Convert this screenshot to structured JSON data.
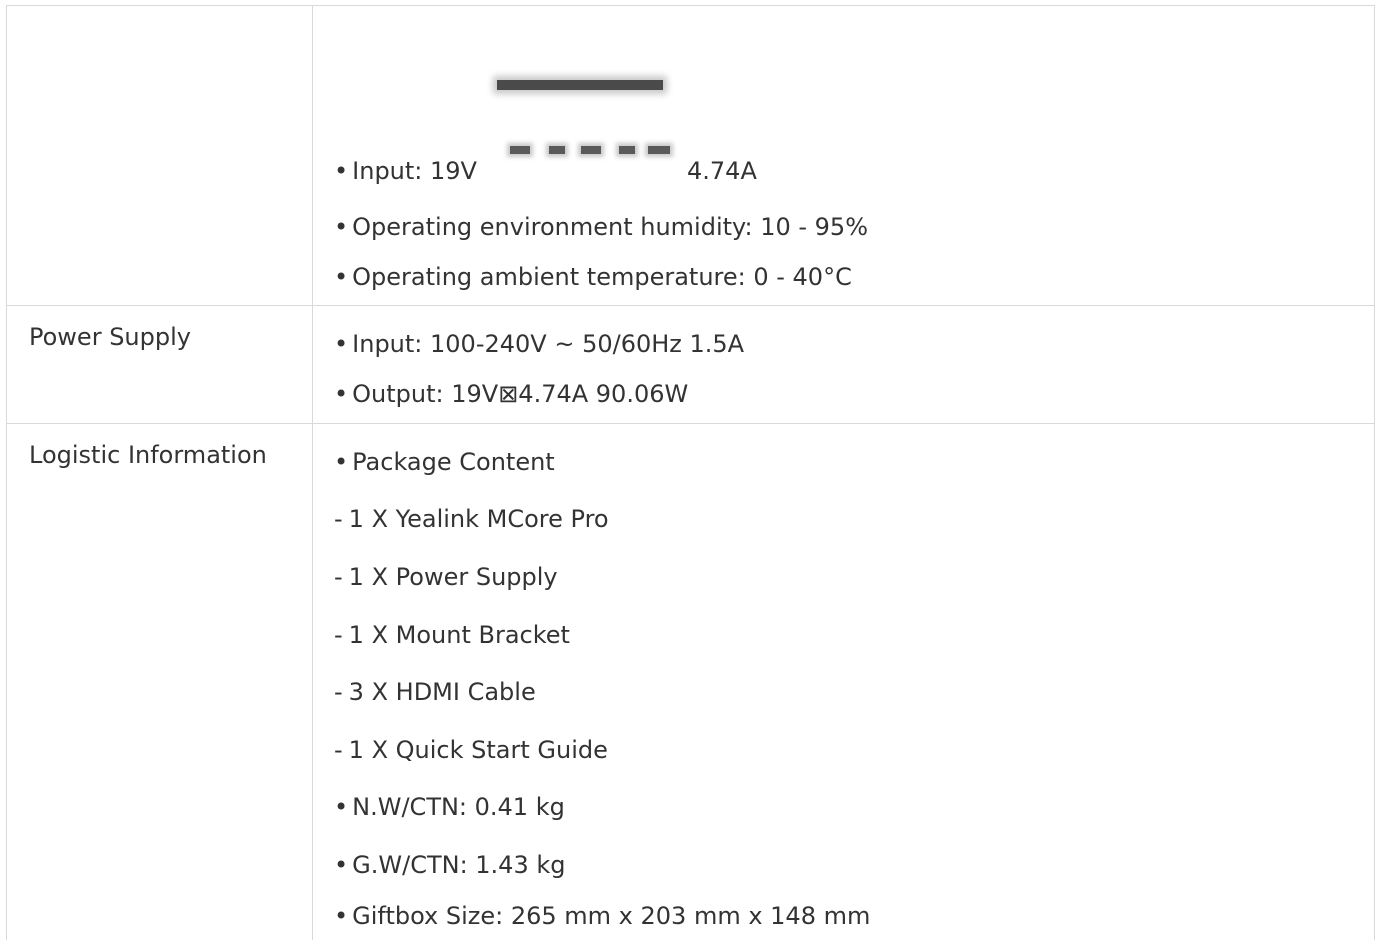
{
  "rows": [
    {
      "label": "",
      "lines": [
        {
          "prefix": "bullet",
          "text": "Input: 19V",
          "suffix": "4.74A"
        },
        {
          "prefix": "bullet",
          "text": "Operating environment humidity: 10 - 95%"
        },
        {
          "prefix": "bullet",
          "text": "Operating ambient temperature: 0 - 40°C"
        }
      ]
    },
    {
      "label": "Power Supply",
      "lines": [
        {
          "prefix": "bullet",
          "text": "Input: 100-240V ~ 50/60Hz 1.5A"
        },
        {
          "prefix": "bullet",
          "text": "Output: 19V⊠4.74A 90.06W"
        }
      ]
    },
    {
      "label": "Logistic Information",
      "lines": [
        {
          "prefix": "bullet",
          "text": "Package Content"
        },
        {
          "prefix": "dash",
          "text": "1 X Yealink MCore Pro"
        },
        {
          "prefix": "dash",
          "text": "1 X Power Supply"
        },
        {
          "prefix": "dash",
          "text": "1 X Mount Bracket"
        },
        {
          "prefix": "dash",
          "text": "3 X HDMI Cable"
        },
        {
          "prefix": "dash",
          "text": "1 X Quick Start Guide"
        },
        {
          "prefix": "bullet",
          "text": "N.W/CTN: 0.41 kg"
        },
        {
          "prefix": "bullet",
          "text": "G.W/CTN: 1.43 kg"
        },
        {
          "prefix": "bullet",
          "text": "Giftbox Size: 265 mm x 203 mm x 148 mm"
        }
      ]
    }
  ],
  "icons": {
    "dc_symbol": "dc-current-symbol-icon"
  }
}
